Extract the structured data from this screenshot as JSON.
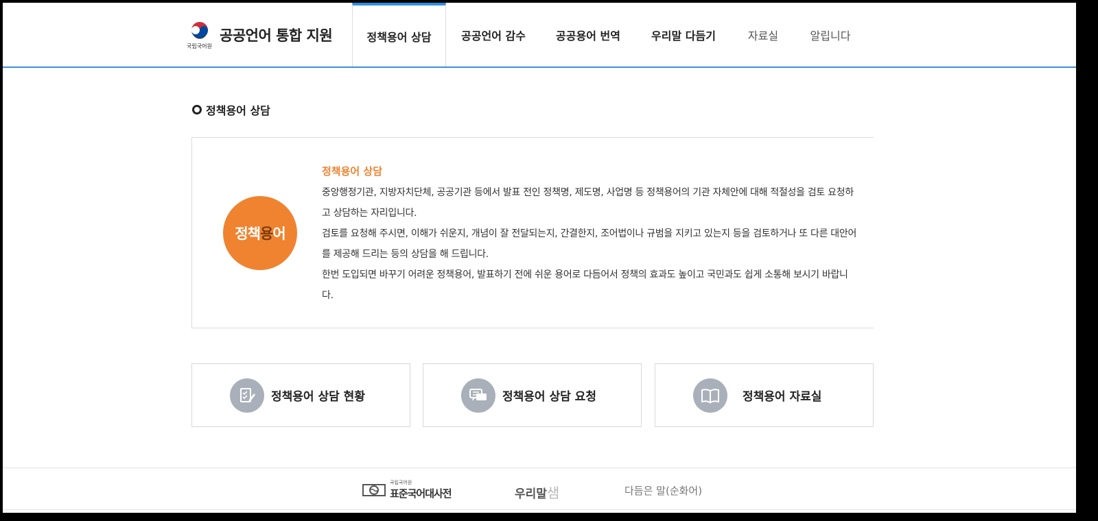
{
  "header": {
    "org_name": "국립국어원",
    "site_title": "공공언어 통합 지원",
    "nav": [
      {
        "label": "정책용어 상담"
      },
      {
        "label": "공공언어 감수"
      },
      {
        "label": "공공용어 번역"
      },
      {
        "label": "우리말 다듬기"
      },
      {
        "label": "자료실"
      },
      {
        "label": "알립니다"
      }
    ]
  },
  "section": {
    "title": "정책용어 상담"
  },
  "intro": {
    "badge_part1": "정책",
    "badge_part2": "용",
    "badge_part3": "어",
    "heading": "정책용어 상담",
    "paragraphs": [
      "중앙행정기관, 지방자치단체, 공공기관 등에서 발표 전인 정책명, 제도명, 사업명 등 정책용어의 기관 자체안에 대해 적절성을 검토 요청하고 상담하는 자리입니다.",
      "검토를 요청해 주시면, 이해가 쉬운지, 개념이 잘 전달되는지, 간결한지, 조어법이나 규범을 지키고 있는지 등을 검토하거나 또 다른 대안어를 제공해 드리는 등의 상담을 해 드립니다.",
      "한번 도입되면 바꾸기 어려운 정책용어, 발표하기 전에 쉬운 용어로 다듬어서 정책의 효과도 높이고 국민과도 쉽게 소통해 보시기 바랍니다."
    ]
  },
  "cards": [
    {
      "label": "정책용어 상담 현황",
      "icon": "checklist-pencil-icon"
    },
    {
      "label": "정책용어 상담 요청",
      "icon": "chat-bubbles-icon"
    },
    {
      "label": "정책용어 자료실",
      "icon": "open-book-icon"
    }
  ],
  "footer": {
    "dict_org": "국립국어원",
    "dict_name": "표준국어대사전",
    "urimal": "우리말",
    "urimal_sam": "샘",
    "purified": "다듬은 말(순화어)"
  },
  "colors": {
    "accent_blue": "#2f8fe0",
    "accent_orange": "#f08330",
    "icon_gray": "#a9b0ba"
  }
}
